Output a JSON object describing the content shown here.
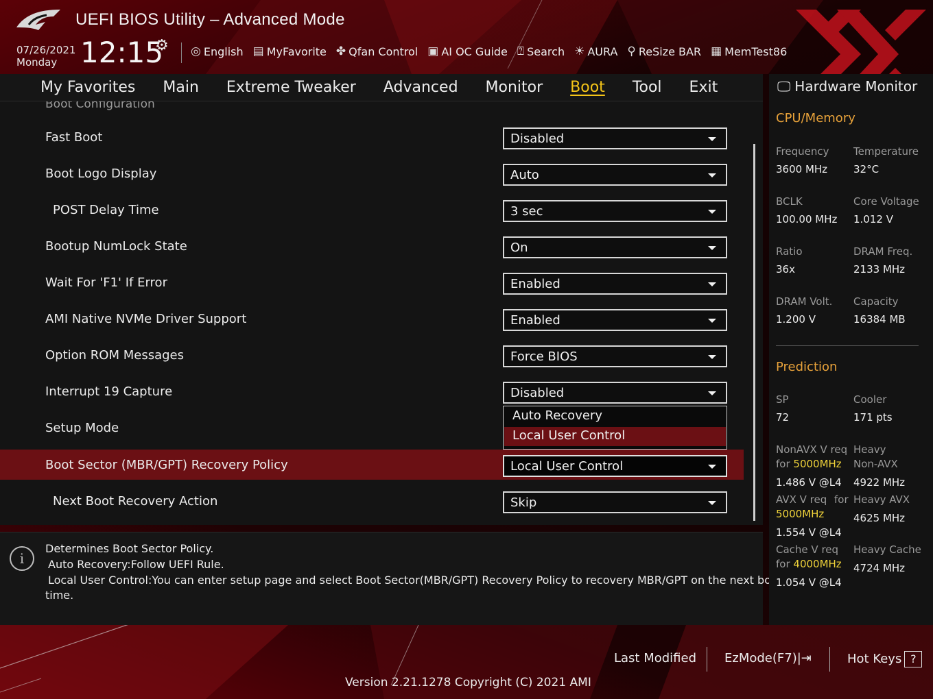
{
  "header": {
    "title": "UEFI BIOS Utility – Advanced Mode",
    "date": "07/26/2021",
    "day": "Monday",
    "time": "12:15",
    "toolbar": [
      {
        "icon": "globe-icon",
        "label": "English"
      },
      {
        "icon": "favorite-list-icon",
        "label": "MyFavorite"
      },
      {
        "icon": "fan-icon",
        "label": "Qfan Control"
      },
      {
        "icon": "ai-chip-icon",
        "label": "AI OC Guide"
      },
      {
        "icon": "search-icon",
        "label": "Search"
      },
      {
        "icon": "aura-light-icon",
        "label": "AURA"
      },
      {
        "icon": "resize-bar-icon",
        "label": "ReSize BAR"
      },
      {
        "icon": "memory-icon",
        "label": "MemTest86"
      }
    ]
  },
  "tabs": [
    {
      "label": "My Favorites",
      "active": false
    },
    {
      "label": "Main",
      "active": false
    },
    {
      "label": "Extreme Tweaker",
      "active": false
    },
    {
      "label": "Advanced",
      "active": false
    },
    {
      "label": "Monitor",
      "active": false
    },
    {
      "label": "Boot",
      "active": true
    },
    {
      "label": "Tool",
      "active": false
    },
    {
      "label": "Exit",
      "active": false
    }
  ],
  "section_header": "Boot Configuration",
  "settings": [
    {
      "label": "Fast Boot",
      "value": "Disabled"
    },
    {
      "label": "Boot Logo Display",
      "value": "Auto"
    },
    {
      "label": "POST Delay Time",
      "value": "3 sec"
    },
    {
      "label": "Bootup NumLock State",
      "value": "On"
    },
    {
      "label": "Wait For 'F1' If Error",
      "value": "Enabled"
    },
    {
      "label": "AMI Native NVMe Driver Support",
      "value": "Enabled"
    },
    {
      "label": "Option ROM Messages",
      "value": "Force BIOS"
    },
    {
      "label": "Interrupt 19 Capture",
      "value": "Disabled"
    },
    {
      "label": "Setup Mode",
      "value": ""
    },
    {
      "label": "Boot Sector (MBR/GPT) Recovery Policy",
      "value": "Local User Control"
    },
    {
      "label": "Next Boot Recovery Action",
      "value": "Skip"
    }
  ],
  "dropdown_options": [
    "Auto Recovery",
    "Local User Control"
  ],
  "help": {
    "line1": "Determines Boot Sector Policy.",
    "line2": "Auto Recovery:Follow UEFI Rule.",
    "line3": "Local User Control:You can enter setup page and select Boot Sector(MBR/GPT) Recovery Policy to recovery MBR/GPT on the next boot",
    "line4": "time."
  },
  "hardware_monitor": {
    "title": "Hardware Monitor",
    "cpu_memory": {
      "heading": "CPU/Memory",
      "frequency_label": "Frequency",
      "frequency": "3600 MHz",
      "temperature_label": "Temperature",
      "temperature": "32°C",
      "bclk_label": "BCLK",
      "bclk": "100.00 MHz",
      "core_voltage_label": "Core Voltage",
      "core_voltage": "1.012 V",
      "ratio_label": "Ratio",
      "ratio": "36x",
      "dram_freq_label": "DRAM Freq.",
      "dram_freq": "2133 MHz",
      "dram_volt_label": "DRAM Volt.",
      "dram_volt": "1.200 V",
      "capacity_label": "Capacity",
      "capacity": "16384 MB"
    },
    "prediction": {
      "heading": "Prediction",
      "sp_label": "SP",
      "sp": "72",
      "cooler_label": "Cooler",
      "cooler": "171 pts",
      "nonavx_req_label": "NonAVX V req",
      "for": "for",
      "nonavx_freq": "5000MHz",
      "nonavx_v": "1.486 V @L4",
      "heavy_label": "Heavy",
      "nonavx_label": "Non-AVX",
      "heavy_nonavx": "4922 MHz",
      "avx_req_label": "AVX V req",
      "avx_freq": "5000MHz",
      "avx_v": "1.554 V @L4",
      "heavy_avx_label": "Heavy AVX",
      "heavy_avx": "4625 MHz",
      "cache_req_label": "Cache V req",
      "cache_freq": "4000MHz",
      "cache_v": "1.054 V @L4",
      "heavy_cache_label": "Heavy Cache",
      "heavy_cache": "4724 MHz"
    }
  },
  "footer": {
    "last_modified": "Last Modified",
    "ezmode": "EzMode(F7)|",
    "hot_keys": "Hot Keys",
    "hot_keys_key": "?",
    "version": "Version 2.21.1278 Copyright (C) 2021 AMI"
  },
  "colors": {
    "accent_active_tab": "#f5c518",
    "section_orange": "#e8a23a",
    "highlight_value": "#f0d33a",
    "selected_row": "#6b1014"
  }
}
